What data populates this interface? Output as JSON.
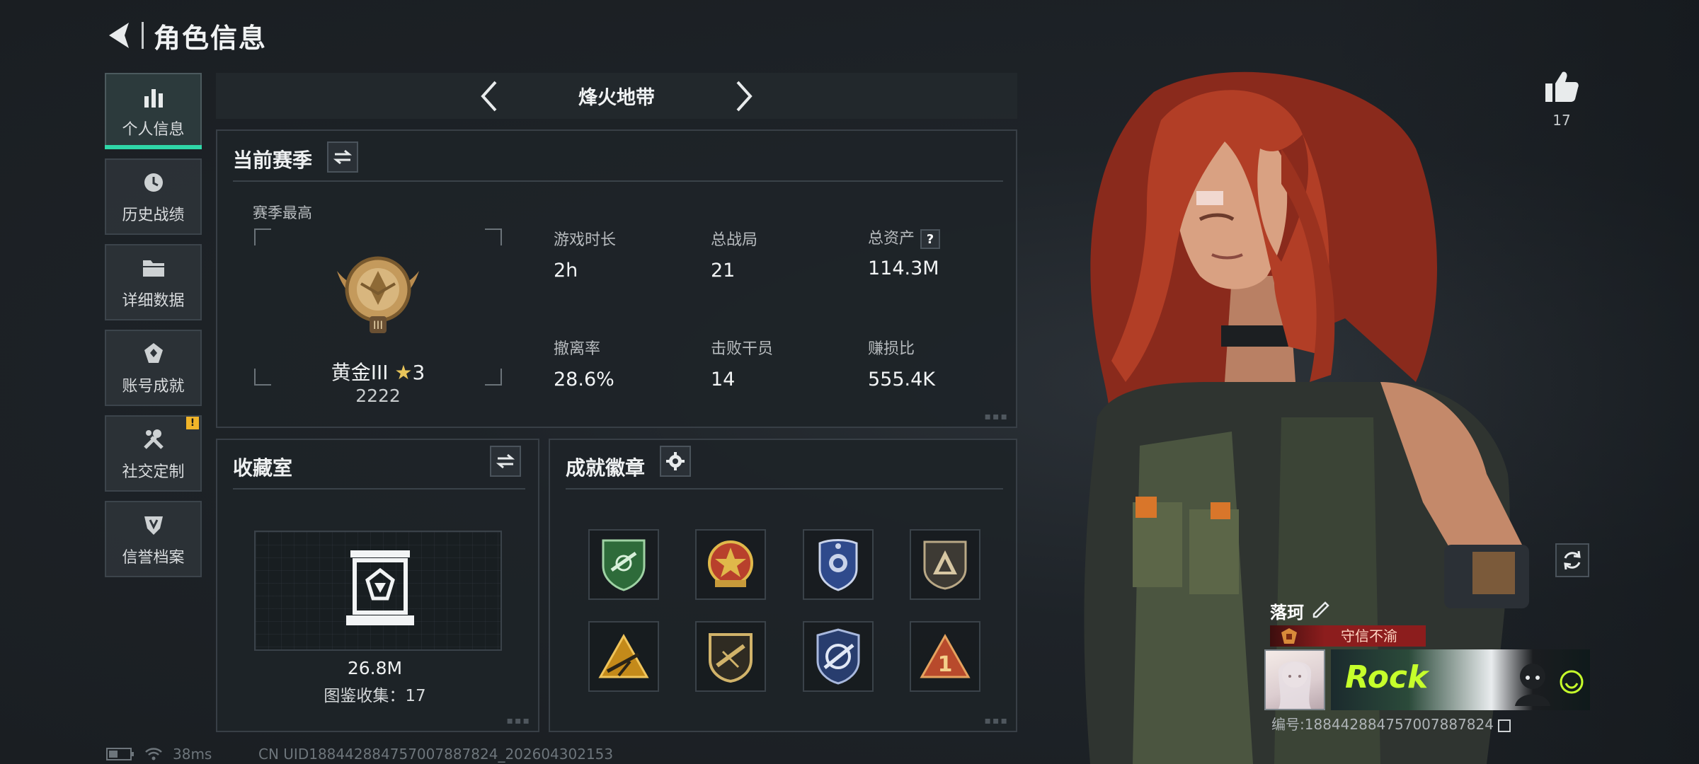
{
  "header": {
    "title": "角色信息"
  },
  "nav": {
    "items": [
      {
        "label": "个人信息",
        "icon": "bar-chart-icon",
        "active": true
      },
      {
        "label": "历史战绩",
        "icon": "history-icon"
      },
      {
        "label": "详细数据",
        "icon": "folder-icon"
      },
      {
        "label": "账号成就",
        "icon": "achievement-icon"
      },
      {
        "label": "社交定制",
        "icon": "tools-icon",
        "badge": "!"
      },
      {
        "label": "信誉档案",
        "icon": "shield-emblem-icon"
      }
    ]
  },
  "mode": {
    "title": "烽火地带"
  },
  "season": {
    "title": "当前赛季",
    "best_label": "赛季最高",
    "rank_name": "黄金III",
    "rank_stars": "3",
    "rank_score": "2222",
    "stats": [
      {
        "label": "游戏时长",
        "value": "2h"
      },
      {
        "label": "总战局",
        "value": "21"
      },
      {
        "label": "总资产",
        "value": "114.3M",
        "help": "?"
      },
      {
        "label": "撤离率",
        "value": "28.6%"
      },
      {
        "label": "击败干员",
        "value": "14"
      },
      {
        "label": "赚损比",
        "value": "555.4K"
      }
    ]
  },
  "collection": {
    "title": "收藏室",
    "value": "26.8M",
    "count_label": "图鉴收集：",
    "count": "17"
  },
  "badges": {
    "title": "成就徽章",
    "items": [
      {
        "name": "green-shield-badge",
        "color": "#2e6b3a"
      },
      {
        "name": "star-medal-badge",
        "color": "#b8402c"
      },
      {
        "name": "blue-police-badge",
        "color": "#2f4a8c"
      },
      {
        "name": "triangle-shield-badge",
        "color": "#8a7a63"
      },
      {
        "name": "gold-triangle-badge",
        "color": "#c48a1a"
      },
      {
        "name": "gold-rifle-badge",
        "color": "#a58a3c"
      },
      {
        "name": "navy-rifle-badge",
        "color": "#283d6e"
      },
      {
        "name": "number-one-badge",
        "color": "#b84a2c"
      }
    ]
  },
  "likes": {
    "count": "17"
  },
  "player": {
    "name": "落珂",
    "title": "守信不渝",
    "banner_text": "Rock",
    "id_label": "编号:",
    "id": "188442884757007887824"
  },
  "status": {
    "ping": "38ms",
    "uid": "CN UID188442884757007887824_202604302153"
  },
  "colors": {
    "accent": "#2fd7a8",
    "badge_warning": "#f0b429",
    "title_red": "#8c1d1d"
  }
}
